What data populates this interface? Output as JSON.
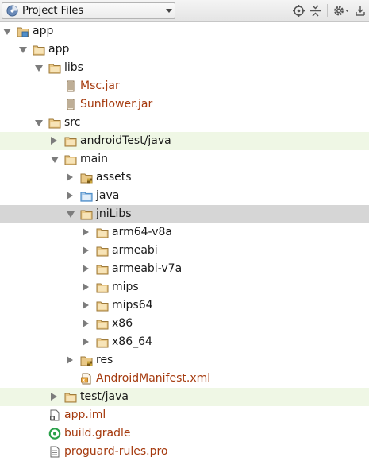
{
  "toolbar": {
    "view_selector": "Project Files",
    "icons": [
      "target-icon",
      "collapse-all-icon",
      "gear-icon",
      "hide-panel-icon"
    ]
  },
  "tree": {
    "rows": [
      {
        "label": "app",
        "depth": 0,
        "expand": "down",
        "icon": "module-icon",
        "kind": "folder",
        "highlight": ""
      },
      {
        "label": "app",
        "depth": 1,
        "expand": "down",
        "icon": "folder-icon",
        "kind": "folder",
        "highlight": ""
      },
      {
        "label": "libs",
        "depth": 2,
        "expand": "down",
        "icon": "folder-icon",
        "kind": "folder",
        "highlight": ""
      },
      {
        "label": "Msc.jar",
        "depth": 3,
        "expand": "",
        "icon": "jar-icon",
        "kind": "file",
        "highlight": ""
      },
      {
        "label": "Sunflower.jar",
        "depth": 3,
        "expand": "",
        "icon": "jar-icon",
        "kind": "file",
        "highlight": ""
      },
      {
        "label": "src",
        "depth": 2,
        "expand": "down",
        "icon": "folder-icon",
        "kind": "folder",
        "highlight": ""
      },
      {
        "label": "androidTest/java",
        "depth": 3,
        "expand": "right",
        "icon": "folder-icon",
        "kind": "folder",
        "highlight": "green"
      },
      {
        "label": "main",
        "depth": 3,
        "expand": "down",
        "icon": "folder-icon",
        "kind": "folder",
        "highlight": ""
      },
      {
        "label": "assets",
        "depth": 4,
        "expand": "right",
        "icon": "resource-folder-icon",
        "kind": "folder",
        "highlight": ""
      },
      {
        "label": "java",
        "depth": 4,
        "expand": "right",
        "icon": "source-folder-icon",
        "kind": "folder",
        "highlight": ""
      },
      {
        "label": "jniLibs",
        "depth": 4,
        "expand": "down",
        "icon": "folder-icon",
        "kind": "folder",
        "highlight": "gray"
      },
      {
        "label": "arm64-v8a",
        "depth": 5,
        "expand": "right",
        "icon": "folder-icon",
        "kind": "folder",
        "highlight": ""
      },
      {
        "label": "armeabi",
        "depth": 5,
        "expand": "right",
        "icon": "folder-icon",
        "kind": "folder",
        "highlight": ""
      },
      {
        "label": "armeabi-v7a",
        "depth": 5,
        "expand": "right",
        "icon": "folder-icon",
        "kind": "folder",
        "highlight": ""
      },
      {
        "label": "mips",
        "depth": 5,
        "expand": "right",
        "icon": "folder-icon",
        "kind": "folder",
        "highlight": ""
      },
      {
        "label": "mips64",
        "depth": 5,
        "expand": "right",
        "icon": "folder-icon",
        "kind": "folder",
        "highlight": ""
      },
      {
        "label": "x86",
        "depth": 5,
        "expand": "right",
        "icon": "folder-icon",
        "kind": "folder",
        "highlight": ""
      },
      {
        "label": "x86_64",
        "depth": 5,
        "expand": "right",
        "icon": "folder-icon",
        "kind": "folder",
        "highlight": ""
      },
      {
        "label": "res",
        "depth": 4,
        "expand": "right",
        "icon": "resource-folder-icon",
        "kind": "folder",
        "highlight": ""
      },
      {
        "label": "AndroidManifest.xml",
        "depth": 4,
        "expand": "",
        "icon": "xml-file-icon",
        "kind": "file",
        "highlight": ""
      },
      {
        "label": "test/java",
        "depth": 3,
        "expand": "right",
        "icon": "folder-icon",
        "kind": "folder",
        "highlight": "green"
      },
      {
        "label": "app.iml",
        "depth": 2,
        "expand": "",
        "icon": "iml-file-icon",
        "kind": "file",
        "highlight": ""
      },
      {
        "label": "build.gradle",
        "depth": 2,
        "expand": "",
        "icon": "gradle-icon",
        "kind": "file",
        "highlight": ""
      },
      {
        "label": "proguard-rules.pro",
        "depth": 2,
        "expand": "",
        "icon": "text-file-icon",
        "kind": "file",
        "highlight": ""
      }
    ]
  },
  "colors": {
    "file_text": "#a53a0e",
    "folder_text": "#1a1a1a",
    "test_highlight": "#eff7e5",
    "selected_highlight": "#d6d6d6",
    "folder_fill": "#e9c887",
    "folder_stroke": "#9e7a3a",
    "source_folder": "#4f8ec9"
  }
}
